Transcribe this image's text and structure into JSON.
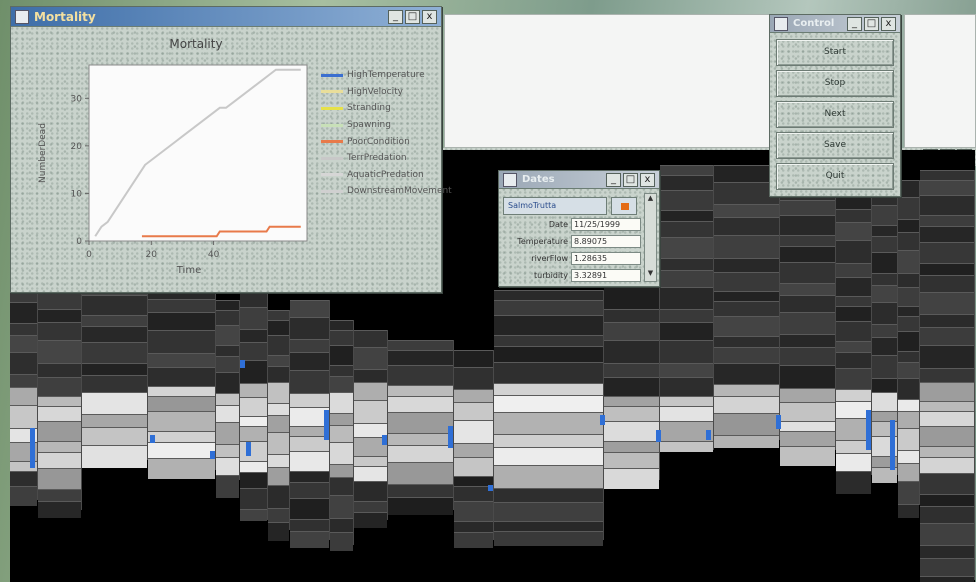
{
  "mortality_window": {
    "title": "Mortality",
    "chart_title": "Mortality",
    "buttons": {
      "minimize": "_",
      "maximize": "□",
      "close": "x"
    }
  },
  "chart_data": {
    "type": "line",
    "title": "Mortality",
    "xlabel": "Time",
    "ylabel": "NumberDead",
    "xlim": [
      0,
      70
    ],
    "ylim": [
      0,
      37
    ],
    "xticks": [
      "0",
      "20",
      "40"
    ],
    "yticks": [
      "0",
      "10",
      "20",
      "30"
    ],
    "grid": false,
    "legend_position": "right",
    "series": [
      {
        "name": "HighTemperature",
        "color": "#3b6fd0",
        "x": [],
        "y": []
      },
      {
        "name": "HighVelocity",
        "color": "#e9de9a",
        "x": [],
        "y": []
      },
      {
        "name": "Stranding",
        "color": "#e6e14a",
        "x": [],
        "y": []
      },
      {
        "name": "Spawning",
        "color": "#c8e0b8",
        "x": [],
        "y": []
      },
      {
        "name": "PoorCondition",
        "color": "#e87a4a",
        "x": [
          17,
          18,
          41,
          42,
          45,
          48,
          51,
          54,
          57,
          58,
          62,
          66,
          68
        ],
        "y": [
          1,
          1,
          1,
          2,
          2,
          2,
          2,
          2,
          2,
          3,
          3,
          3,
          3
        ]
      },
      {
        "name": "TerrPredation",
        "color": "#c8c8c8",
        "x": [
          2,
          4,
          6,
          8,
          10,
          12,
          14,
          16,
          18,
          20,
          22,
          24,
          26,
          28,
          30,
          32,
          34,
          36,
          38,
          40,
          42,
          44,
          46,
          48,
          50,
          52,
          54,
          56,
          58,
          60,
          62,
          64,
          66,
          68
        ],
        "y": [
          1,
          3,
          4,
          6,
          8,
          10,
          12,
          14,
          16,
          17,
          18,
          19,
          20,
          21,
          22,
          23,
          24,
          25,
          26,
          27,
          28,
          28,
          29,
          30,
          31,
          32,
          33,
          34,
          35,
          36,
          36,
          36,
          36,
          36
        ]
      },
      {
        "name": "AquaticPredation",
        "color": "#d6d6d6",
        "x": [],
        "y": []
      },
      {
        "name": "DownstreamMovement",
        "color": "#d0d0d0",
        "x": [],
        "y": []
      }
    ]
  },
  "date_window": {
    "title": "Dates",
    "select_value": "SalmoTrutta",
    "swatch_color": "#e46b15",
    "fields": [
      {
        "label": "Date",
        "value": "11/25/1999"
      },
      {
        "label": "Temperature",
        "value": "8.89075"
      },
      {
        "label": "riverFlow",
        "value": "1.28635"
      },
      {
        "label": "turbidity",
        "value": "3.32891"
      }
    ],
    "buttons": {
      "minimize": "_",
      "maximize": "□",
      "close": "x"
    }
  },
  "control_window": {
    "title": "Control",
    "buttons": {
      "minimize": "_",
      "maximize": "□",
      "close": "x"
    },
    "actions": [
      "Start",
      "Stop",
      "Next",
      "Save",
      "Quit"
    ]
  },
  "habitat_window": {
    "buttons": {
      "minimize": "_",
      "maximize": "□",
      "close": "x"
    }
  },
  "colors": {
    "selection": "#2f6fd6",
    "cell_dark": "#2b2b2b",
    "cell_light": "#d8d8d8"
  }
}
